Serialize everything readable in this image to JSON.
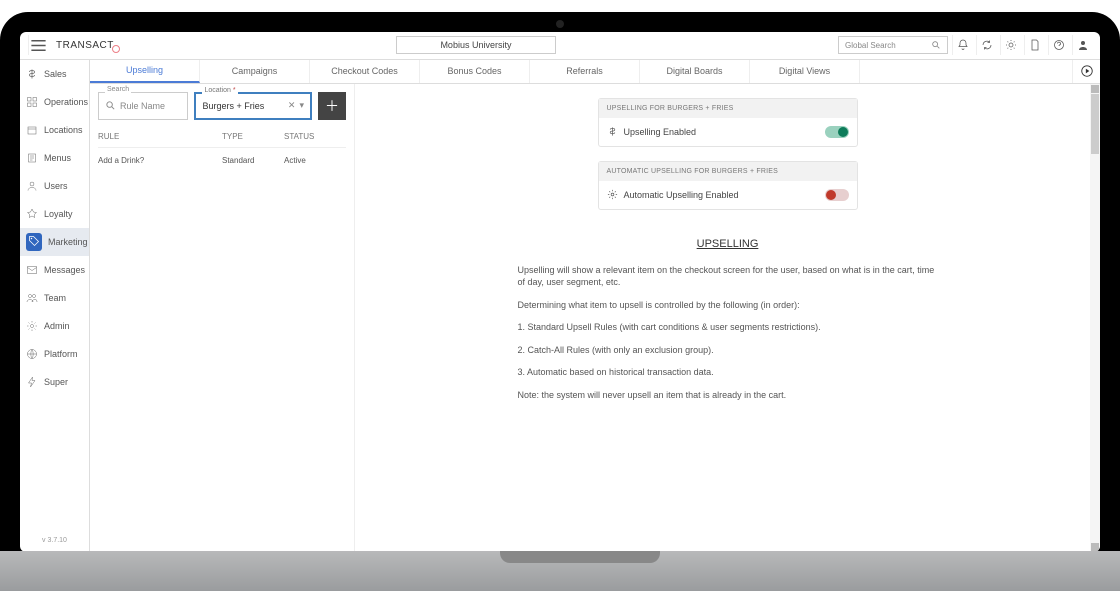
{
  "brand": "TRANSACT",
  "org_title": "Mobius University",
  "global_search_placeholder": "Global Search",
  "version": "v 3.7.10",
  "sidebar": [
    {
      "label": "Sales"
    },
    {
      "label": "Operations"
    },
    {
      "label": "Locations"
    },
    {
      "label": "Menus"
    },
    {
      "label": "Users"
    },
    {
      "label": "Loyalty"
    },
    {
      "label": "Marketing"
    },
    {
      "label": "Messages"
    },
    {
      "label": "Team"
    },
    {
      "label": "Admin"
    },
    {
      "label": "Platform"
    },
    {
      "label": "Super"
    }
  ],
  "tabs": [
    {
      "label": "Upselling"
    },
    {
      "label": "Campaigns"
    },
    {
      "label": "Checkout Codes"
    },
    {
      "label": "Bonus Codes"
    },
    {
      "label": "Referrals"
    },
    {
      "label": "Digital Boards"
    },
    {
      "label": "Digital Views"
    }
  ],
  "filters": {
    "search_label": "Search",
    "search_placeholder": "Rule Name",
    "location_label": "Location",
    "location_value": "Burgers + Fries"
  },
  "table": {
    "headers": {
      "rule": "RULE",
      "type": "TYPE",
      "status": "STATUS"
    },
    "rows": [
      {
        "rule": "Add a Drink?",
        "type": "Standard",
        "status": "Active"
      }
    ]
  },
  "cards": {
    "upsell_head": "UPSELLING FOR BURGERS + FRIES",
    "upsell_label": "Upselling Enabled",
    "auto_head": "AUTOMATIC UPSELLING FOR BURGERS + FRIES",
    "auto_label": "Automatic Upselling Enabled"
  },
  "info": {
    "title": "UPSELLING",
    "p1": "Upselling will show a relevant item on the checkout screen for the user, based on what is in the cart, time of day, user segment, etc.",
    "p2": "Determining what item to upsell is controlled by the following (in order):",
    "p3": "1. Standard Upsell Rules (with cart conditions & user segments restrictions).",
    "p4": "2. Catch-All Rules (with only an exclusion group).",
    "p5": "3. Automatic based on historical transaction data.",
    "p6": "Note: the system will never upsell an item that is already in the cart."
  }
}
